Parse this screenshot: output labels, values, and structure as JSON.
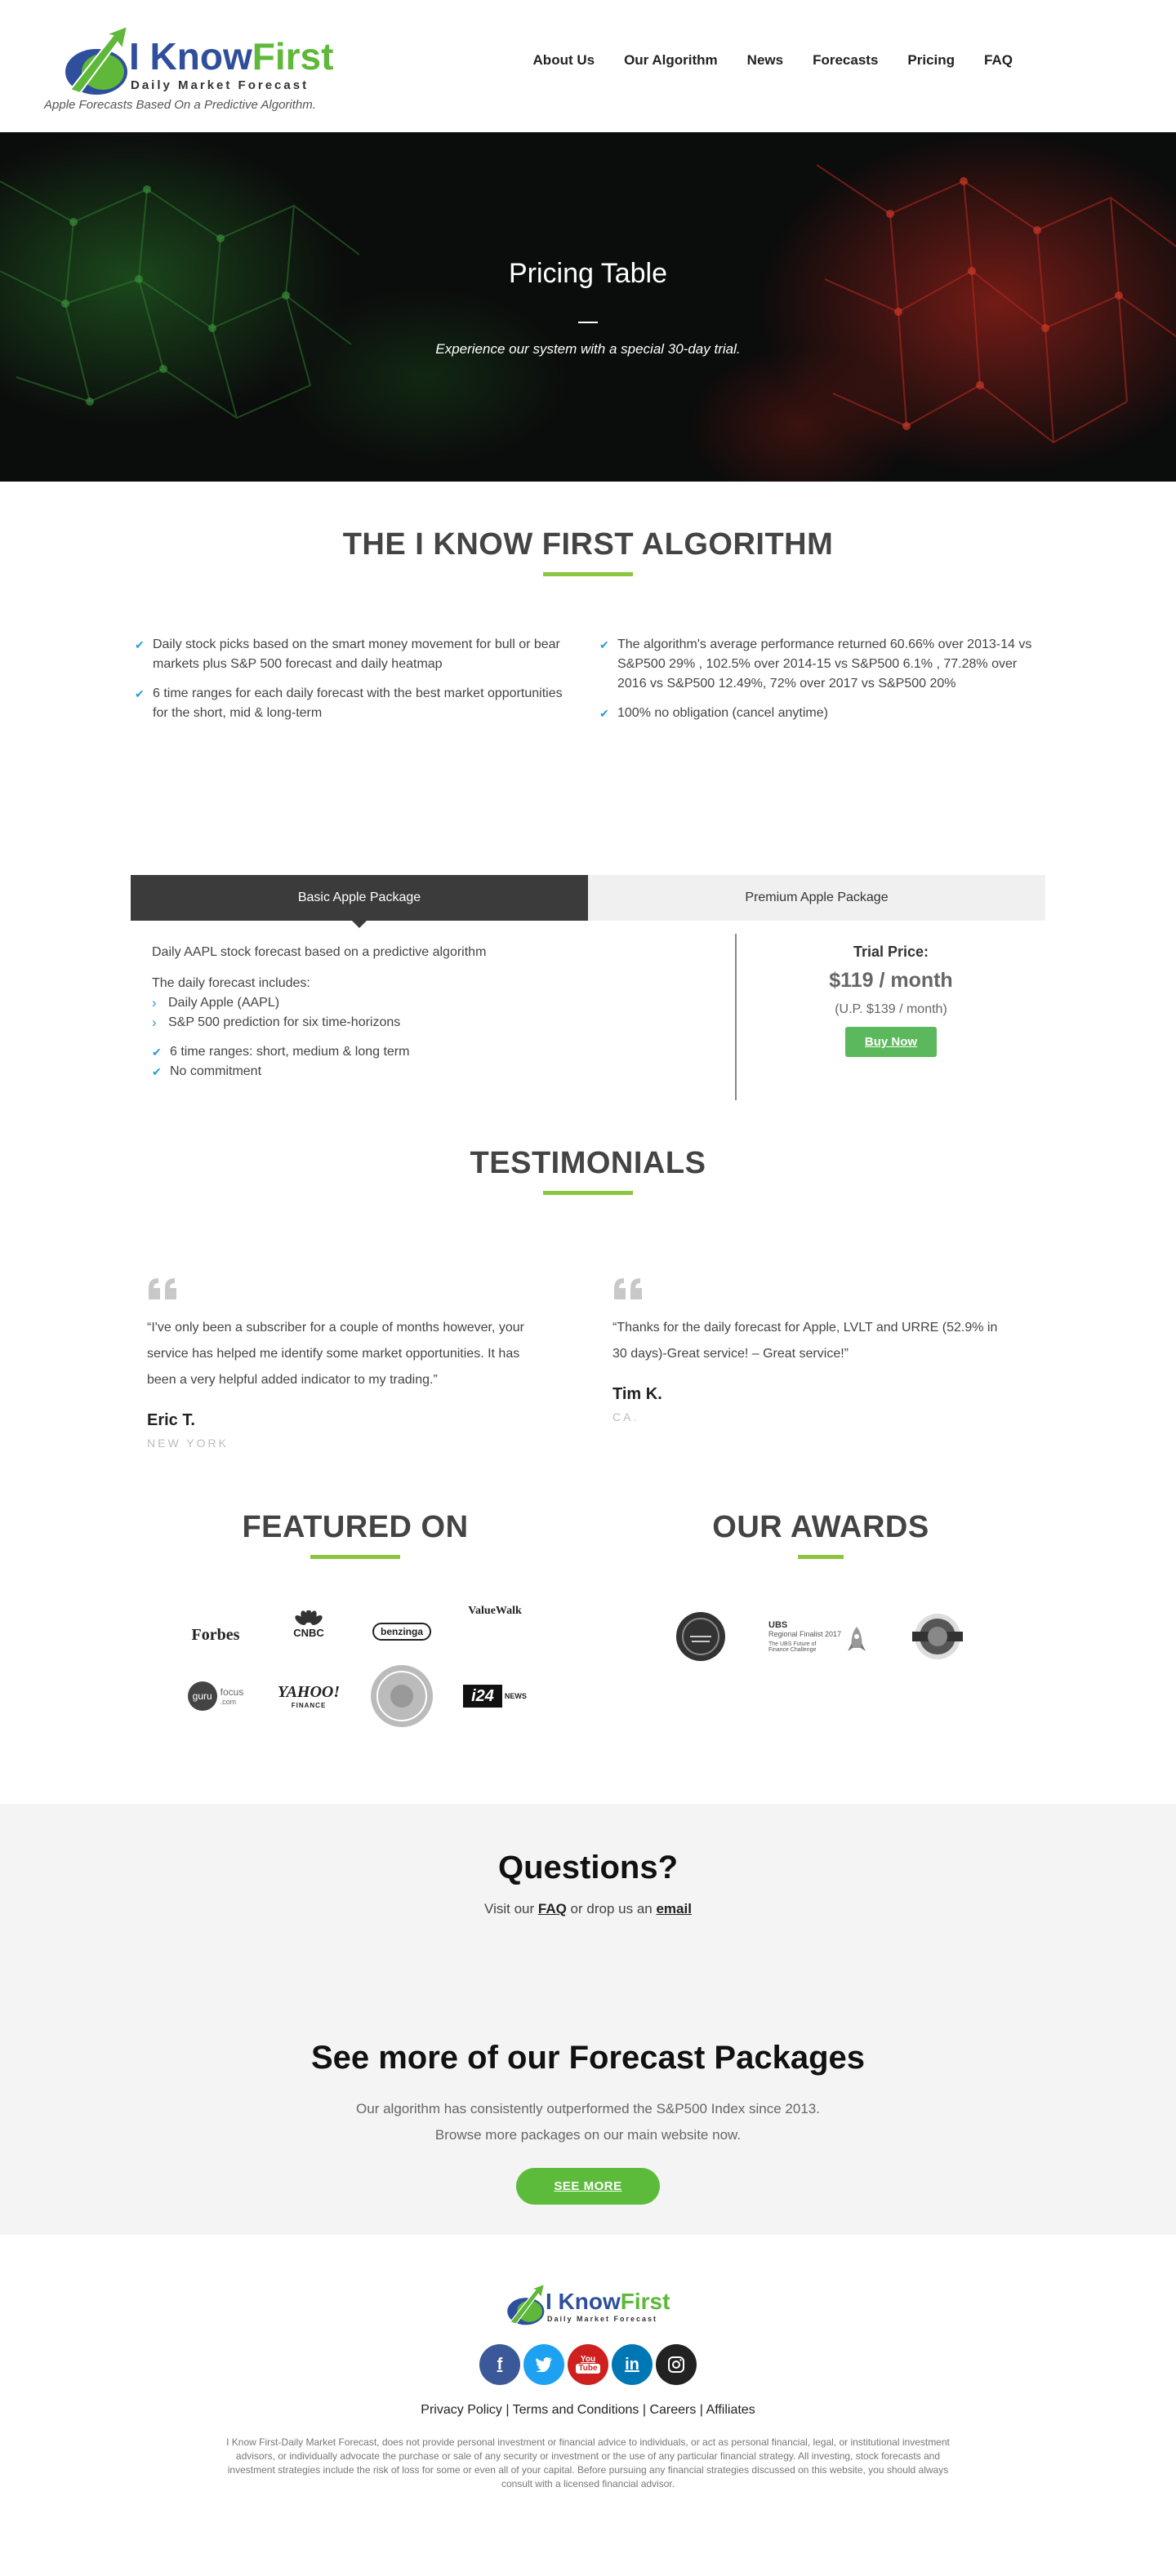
{
  "header": {
    "logo_part1": "I Know",
    "logo_part2": "First",
    "logo_sub": "Daily Market Forecast",
    "tagline": "Apple Forecasts Based On a Predictive Algorithm.",
    "nav": [
      "About Us",
      "Our Algorithm",
      "News",
      "Forecasts",
      "Pricing",
      "FAQ"
    ]
  },
  "hero": {
    "title": "Pricing Table",
    "subtitle": "Experience our system with a special 30-day trial."
  },
  "algorithm": {
    "title": "THE I KNOW FIRST ALGORITHM",
    "left": [
      "Daily stock picks based on the smart money movement for bull or bear markets plus S&P 500 forecast and daily heatmap",
      "6 time ranges for each daily forecast with the best market opportunities for the short, mid & long-term"
    ],
    "right": [
      "The algorithm's average performance returned 60.66% over 2013-14 vs S&P500 29% , 102.5% over 2014-15 vs S&P500 6.1% , 77.28% over 2016 vs S&P500 12.49%, 72% over 2017 vs S&P500 20%",
      "100% no obligation (cancel anytime)"
    ]
  },
  "pricing": {
    "tab_basic": "Basic Apple Package",
    "tab_premium": "Premium Apple Package",
    "description": "Daily AAPL stock forecast based on a predictive algorithm",
    "includes_label": "The daily forecast includes:",
    "includes": [
      "Daily Apple (AAPL)",
      "S&P 500 prediction for six time-horizons"
    ],
    "checks": [
      "6 time ranges: short, medium & long term",
      "No commitment"
    ],
    "trial_label": "Trial Price:",
    "trial_price": "$119 / month",
    "regular_price": "(U.P. $139 / month)",
    "buy_label": "Buy Now"
  },
  "testimonials": {
    "title": "TESTIMONIALS",
    "items": [
      {
        "text": "“I've only been a subscriber for a couple of months however, your service has helped me identify some market opportunities. It has been a very helpful added indicator to my trading.”",
        "name": "Eric T.",
        "location": "NEW YORK"
      },
      {
        "text": "“Thanks for the daily forecast for Apple, LVLT and URRE (52.9% in 30 days)-Great service! – Great service!”",
        "name": "Tim K.",
        "location": "CA."
      }
    ]
  },
  "featured": {
    "title": "FEATURED ON",
    "logos": [
      "Forbes",
      "CNBC",
      "benzinga",
      "ValueWalk",
      "guru",
      "focus",
      ".com",
      "YAHOO!",
      "FINANCE",
      "i24",
      "NEWS"
    ]
  },
  "awards": {
    "title": "OUR AWARDS",
    "items": [
      "UBS",
      "Regional Finalist 2017",
      "The UBS Future of Finance Challenge"
    ]
  },
  "questions": {
    "title": "Questions?",
    "prefix": "Visit our ",
    "faq_link": "FAQ",
    "middle": " or drop us an ",
    "email_link": "email"
  },
  "more": {
    "title": "See more of our Forecast Packages",
    "line1": "Our algorithm has consistently outperformed the S&P500 Index since 2013.",
    "line2": "Browse more packages on our main website now.",
    "button": "SEE MORE"
  },
  "footer": {
    "links": [
      "Privacy Policy",
      "Terms and Conditions",
      "Careers",
      "Affiliates"
    ],
    "disclaimer": "I Know First-Daily Market Forecast, does not provide personal investment or financial advice to individuals, or act as personal financial, legal, or institutional investment advisors, or individually advocate the purchase or sale of any security or investment or the use of any particular financial strategy. All investing, stock forecasts and investment strategies include the risk of loss for some or even all of your capital. Before pursuing any financial strategies discussed on this website, you should always consult with a licensed financial advisor.",
    "social_colors": {
      "facebook": "#3b5998",
      "twitter": "#1da1f2",
      "youtube": "#cd201f",
      "linkedin": "#0077b5",
      "instagram": "#222222"
    }
  },
  "colors": {
    "accent_green": "#8cc63f",
    "button_green": "#5cb85c",
    "check_blue": "#2a9bd8"
  }
}
